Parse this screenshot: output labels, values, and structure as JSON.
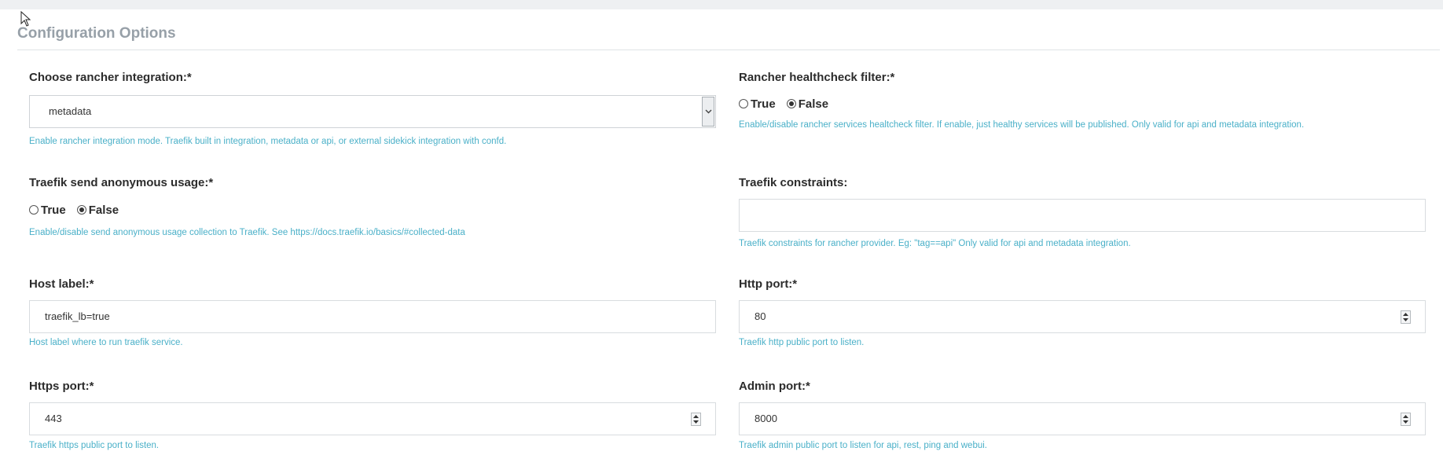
{
  "section": {
    "title": "Configuration Options"
  },
  "fields": {
    "rancher_integration": {
      "label": "Choose rancher integration:*",
      "value": "metadata",
      "help": "Enable rancher integration mode. Traefik built in integration, metadata or api, or external sidekick integration with confd."
    },
    "healthcheck_filter": {
      "label": "Rancher healthcheck filter:*",
      "options": [
        "True",
        "False"
      ],
      "selected": "False",
      "help": "Enable/disable rancher services healtcheck filter. If enable, just healthy services will be published. Only valid for api and metadata integration."
    },
    "anonymous_usage": {
      "label": "Traefik send anonymous usage:*",
      "options": [
        "True",
        "False"
      ],
      "selected": "False",
      "help": "Enable/disable send anonymous usage collection to Traefik. See https://docs.traefik.io/basics/#collected-data"
    },
    "constraints": {
      "label": "Traefik constraints:",
      "value": "",
      "help": "Traefik constraints for rancher provider. Eg: \"tag==api\" Only valid for api and metadata integration."
    },
    "host_label": {
      "label": "Host label:*",
      "value": "traefik_lb=true",
      "help": "Host label where to run traefik service."
    },
    "http_port": {
      "label": "Http port:*",
      "value": "80",
      "help": "Traefik http public port to listen."
    },
    "https_port": {
      "label": "Https port:*",
      "value": "443",
      "help": "Traefik https public port to listen."
    },
    "admin_port": {
      "label": "Admin port:*",
      "value": "8000",
      "help": "Traefik admin public port to listen for api, rest, ping and webui."
    }
  }
}
